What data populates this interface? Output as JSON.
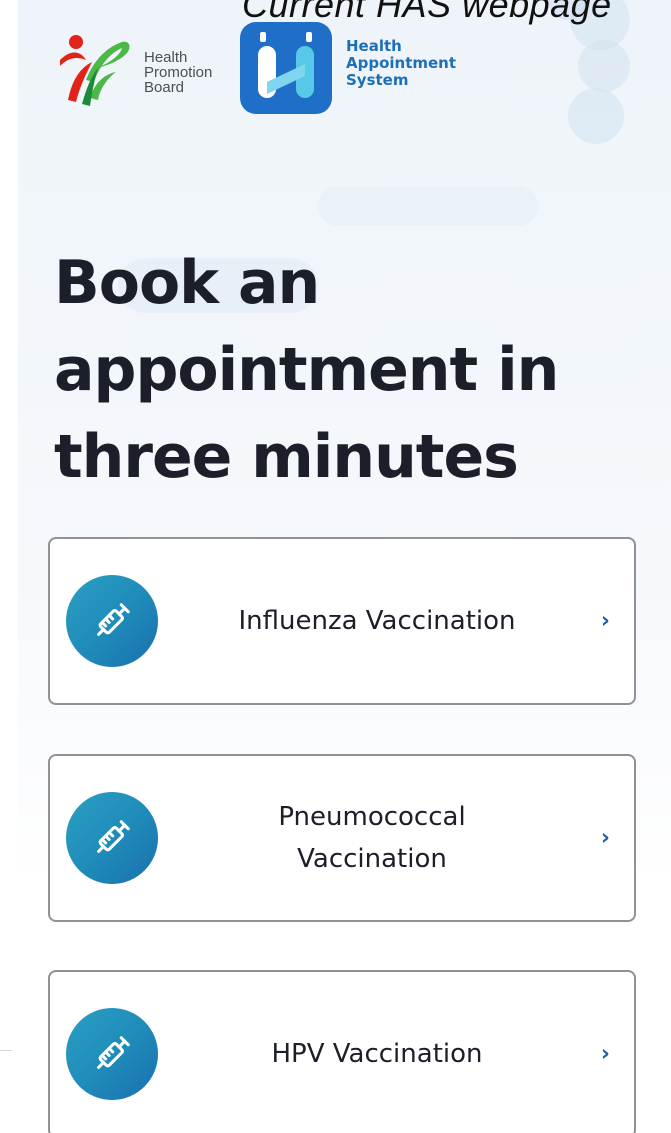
{
  "caption": "Current HAS webpage",
  "header": {
    "hpb_logo_lines": [
      "Health",
      "Promotion",
      "Board"
    ],
    "has_logo_lines": [
      "Health",
      "Appointment",
      "System"
    ]
  },
  "main": {
    "headline_lines": [
      "Book an",
      "appointment in",
      "three minutes"
    ],
    "services": [
      {
        "label": "Influenza Vaccination",
        "icon": "syringe-icon",
        "chevron": "›"
      },
      {
        "label": "Pneumococcal Vaccination",
        "icon": "syringe-icon",
        "chevron": "›"
      },
      {
        "label": "HPV Vaccination",
        "icon": "syringe-icon",
        "chevron": "›"
      }
    ]
  },
  "colors": {
    "accent_blue": "#1d6fb8",
    "icon_gradient_start": "#2aa0c4",
    "icon_gradient_end": "#1b6fae",
    "heading": "#1c1f2a",
    "card_border": "#8f9196"
  }
}
